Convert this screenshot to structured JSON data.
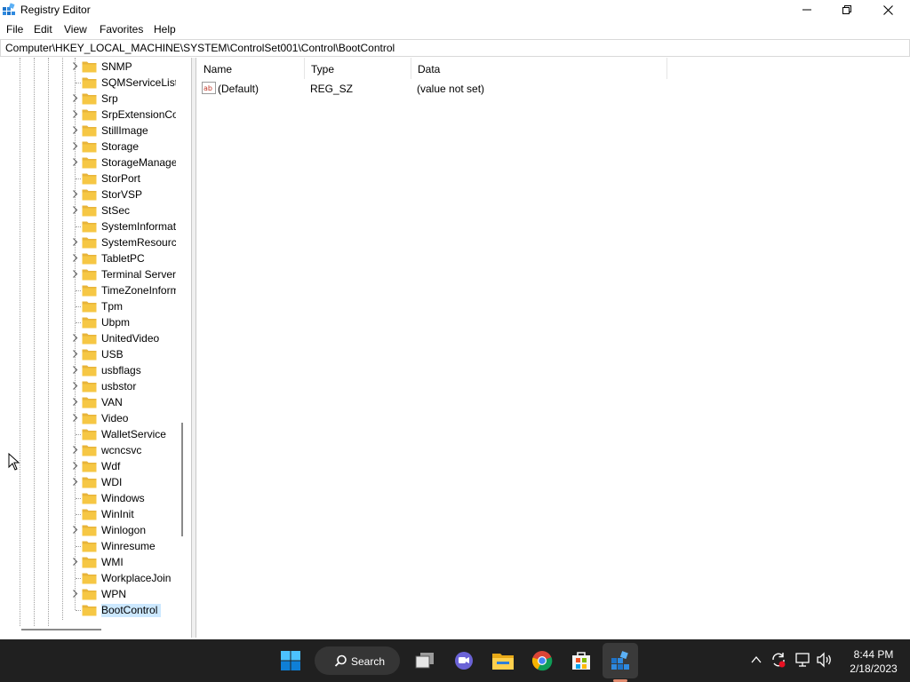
{
  "window": {
    "title": "Registry Editor",
    "controls": [
      "minimize-icon",
      "restore-icon",
      "close-icon"
    ]
  },
  "menu": [
    "File",
    "Edit",
    "View",
    "Favorites",
    "Help"
  ],
  "address": "Computer\\HKEY_LOCAL_MACHINE\\SYSTEM\\ControlSet001\\Control\\BootControl",
  "tree": {
    "items": [
      {
        "label": "SNMP",
        "expandable": true
      },
      {
        "label": "SQMServiceList",
        "expandable": false
      },
      {
        "label": "Srp",
        "expandable": true
      },
      {
        "label": "SrpExtensionConfig",
        "expandable": true
      },
      {
        "label": "StillImage",
        "expandable": true
      },
      {
        "label": "Storage",
        "expandable": true
      },
      {
        "label": "StorageManagement",
        "expandable": true
      },
      {
        "label": "StorPort",
        "expandable": false
      },
      {
        "label": "StorVSP",
        "expandable": true
      },
      {
        "label": "StSec",
        "expandable": true
      },
      {
        "label": "SystemInformation",
        "expandable": false
      },
      {
        "label": "SystemResources",
        "expandable": true
      },
      {
        "label": "TabletPC",
        "expandable": true
      },
      {
        "label": "Terminal Server",
        "expandable": true
      },
      {
        "label": "TimeZoneInformation",
        "expandable": false
      },
      {
        "label": "Tpm",
        "expandable": false
      },
      {
        "label": "Ubpm",
        "expandable": false
      },
      {
        "label": "UnitedVideo",
        "expandable": true
      },
      {
        "label": "USB",
        "expandable": true
      },
      {
        "label": "usbflags",
        "expandable": true
      },
      {
        "label": "usbstor",
        "expandable": true
      },
      {
        "label": "VAN",
        "expandable": true
      },
      {
        "label": "Video",
        "expandable": true
      },
      {
        "label": "WalletService",
        "expandable": false
      },
      {
        "label": "wcncsvc",
        "expandable": true
      },
      {
        "label": "Wdf",
        "expandable": true
      },
      {
        "label": "WDI",
        "expandable": true
      },
      {
        "label": "Windows",
        "expandable": false
      },
      {
        "label": "WinInit",
        "expandable": false
      },
      {
        "label": "Winlogon",
        "expandable": true
      },
      {
        "label": "Winresume",
        "expandable": false
      },
      {
        "label": "WMI",
        "expandable": true
      },
      {
        "label": "WorkplaceJoin",
        "expandable": false
      },
      {
        "label": "WPN",
        "expandable": true
      },
      {
        "label": "BootControl",
        "expandable": false,
        "selected": true
      }
    ]
  },
  "list": {
    "columns": [
      "Name",
      "Type",
      "Data"
    ],
    "rows": [
      {
        "name": "(Default)",
        "type": "REG_SZ",
        "data": "(value not set)",
        "icon": "string-value-icon"
      }
    ]
  },
  "taskbar": {
    "search_label": "Search",
    "apps": [
      "windows-start-icon",
      "search-icon",
      "task-view-icon",
      "chat-icon",
      "file-explorer-icon",
      "chrome-icon",
      "store-icon",
      "registry-editor-icon"
    ],
    "tray": [
      "chevron-up-icon",
      "sync-icon",
      "network-icon",
      "volume-icon"
    ],
    "time": "8:44 PM",
    "date": "2/18/2023"
  },
  "colors": {
    "taskbar": "#202020",
    "selection": "#cce8ff",
    "folder": "#f6c744"
  }
}
